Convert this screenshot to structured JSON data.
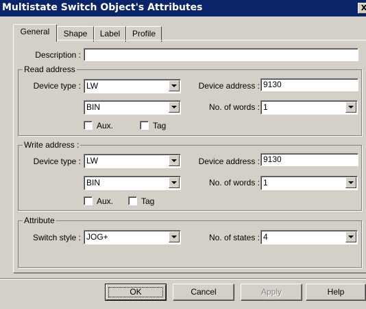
{
  "window": {
    "title": "Multistate Switch Object's Attributes",
    "close_glyph": "X"
  },
  "tabs": [
    {
      "label": "General",
      "active": true
    },
    {
      "label": "Shape",
      "active": false
    },
    {
      "label": "Label",
      "active": false
    },
    {
      "label": "Profile",
      "active": false
    }
  ],
  "general": {
    "description_label": "Description :",
    "description_value": "",
    "read": {
      "title": "Read address",
      "device_type_label": "Device type :",
      "device_type": "LW",
      "format": "BIN",
      "device_address_label": "Device address :",
      "device_address": "9130",
      "words_label": "No. of words :",
      "words": "1",
      "aux_label": "Aux.",
      "aux_checked": false,
      "tag_label": "Tag",
      "tag_checked": false
    },
    "write": {
      "title": "Write address :",
      "device_type_label": "Device type :",
      "device_type": "LW",
      "format": "BIN",
      "device_address_label": "Device  address :",
      "device_address": "9130",
      "words_label": "No. of words :",
      "words": "1",
      "aux_label": "Aux.",
      "aux_checked": false,
      "tag_label": "Tag",
      "tag_checked": false
    },
    "attribute": {
      "title": "Attribute",
      "switch_style_label": "Switch style :",
      "switch_style": "JOG+",
      "states_label": "No. of states :",
      "states": "4"
    }
  },
  "buttons": {
    "ok": "OK",
    "cancel": "Cancel",
    "apply": "Apply",
    "help": "Help"
  }
}
